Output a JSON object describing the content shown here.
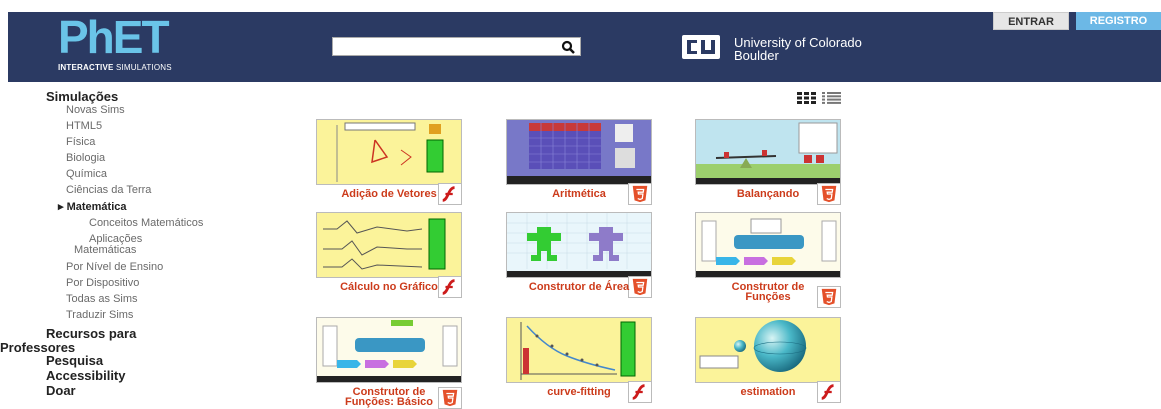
{
  "header": {
    "logo_main": "PhET",
    "logo_sub_bold": "INTERACTIVE",
    "logo_sub_rest": " SIMULATIONS",
    "search_placeholder": "",
    "university_line1": "University of Colorado",
    "university_line2": "Boulder",
    "login_label": "ENTRAR",
    "register_label": "REGISTRO"
  },
  "sidebar": {
    "simulations": "Simulações",
    "items": [
      "Novas Sims",
      "HTML5",
      "Física",
      "Biologia",
      "Química",
      "Ciências da Terra"
    ],
    "active": "Matemática",
    "active_marker": "▸",
    "subitems": [
      "Conceitos Matemáticos"
    ],
    "subitem2_line1": "Aplicações",
    "subitem2_line2": "Matemáticas",
    "more_items": [
      "Por Nível de Ensino",
      "Por Dispositivo",
      "Todas as Sims",
      "Traduzir Sims"
    ],
    "teacher_line1": "Recursos para",
    "teacher_line2": "Professores",
    "research": "Pesquisa",
    "accessibility": "Accessibility",
    "donate": "Doar"
  },
  "sims": [
    {
      "line1": "Adição de Vetores",
      "line2": "",
      "tech": "flash"
    },
    {
      "line1": "Aritmética",
      "line2": "",
      "tech": "html5"
    },
    {
      "line1": "Balançando",
      "line2": "",
      "tech": "html5"
    },
    {
      "line1": "Cálculo no Gráfico",
      "line2": "",
      "tech": "flash"
    },
    {
      "line1": "Construtor de Área",
      "line2": "",
      "tech": "html5"
    },
    {
      "line1": "Construtor de",
      "line2": "Funções",
      "tech": "html5"
    },
    {
      "line1": "Construtor de",
      "line2": "Funções: Básico",
      "tech": "html5"
    },
    {
      "line1": "curve-fitting",
      "line2": "",
      "tech": "flash"
    },
    {
      "line1": "estimation",
      "line2": "",
      "tech": "flash"
    }
  ],
  "colors": {
    "header_bg": "#2b3a63",
    "logo_blue": "#6ac4e8",
    "register_bg": "#6cb8e6",
    "sim_title": "#cc3b1b",
    "html5_badge": "#e4502a",
    "flash_badge": "#cc1b1b"
  },
  "icons": {
    "search": "magnifier-icon",
    "flash": "flash-badge-icon",
    "html5": "html5-badge-icon",
    "grid": "grid-view-icon",
    "list": "list-view-icon"
  }
}
